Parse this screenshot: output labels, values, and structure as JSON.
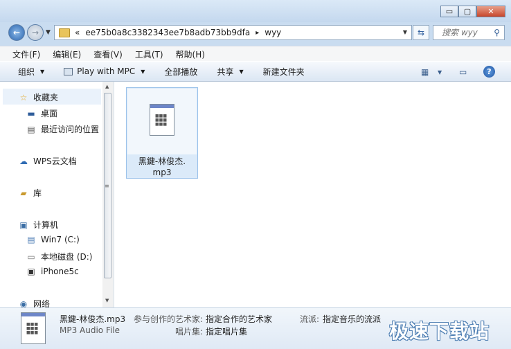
{
  "window": {
    "controls": {
      "minimize": "▭",
      "maximize": "▢",
      "close": "✕"
    }
  },
  "address": {
    "chevron": "«",
    "breadcrumb": [
      "ee75b0a8c3382343ee7b8adb73bb9dfa",
      "wyy"
    ],
    "separator": "▸",
    "search_placeholder": "搜索 wyy"
  },
  "menu": [
    "文件(F)",
    "编辑(E)",
    "查看(V)",
    "工具(T)",
    "帮助(H)"
  ],
  "toolbar": {
    "organize": "组织",
    "play_with": "Play with MPC",
    "play_all": "全部播放",
    "share": "共享",
    "new_folder": "新建文件夹",
    "help": "?"
  },
  "nav": {
    "favorites": "收藏夹",
    "desktop": "桌面",
    "recent": "最近访问的位置",
    "wps": "WPS云文档",
    "library": "库",
    "computer": "计算机",
    "drive_c": "Win7 (C:)",
    "drive_d": "本地磁盘 (D:)",
    "iphone": "iPhone5c",
    "network": "网络"
  },
  "files": [
    {
      "name": "黑鍵-林俊杰.\nmp3",
      "icon": "audio-file-icon"
    }
  ],
  "details": {
    "name": "黑鍵-林俊杰.mp3",
    "type": "MP3 Audio File",
    "contributing_artist_label": "参与创作的艺术家:",
    "contributing_artist_value": "指定合作的艺术家",
    "album_label": "唱片集:",
    "album_value": "指定唱片集",
    "genre_label": "流派:",
    "genre_value": "指定音乐的流派"
  },
  "watermark": "极速下载站"
}
